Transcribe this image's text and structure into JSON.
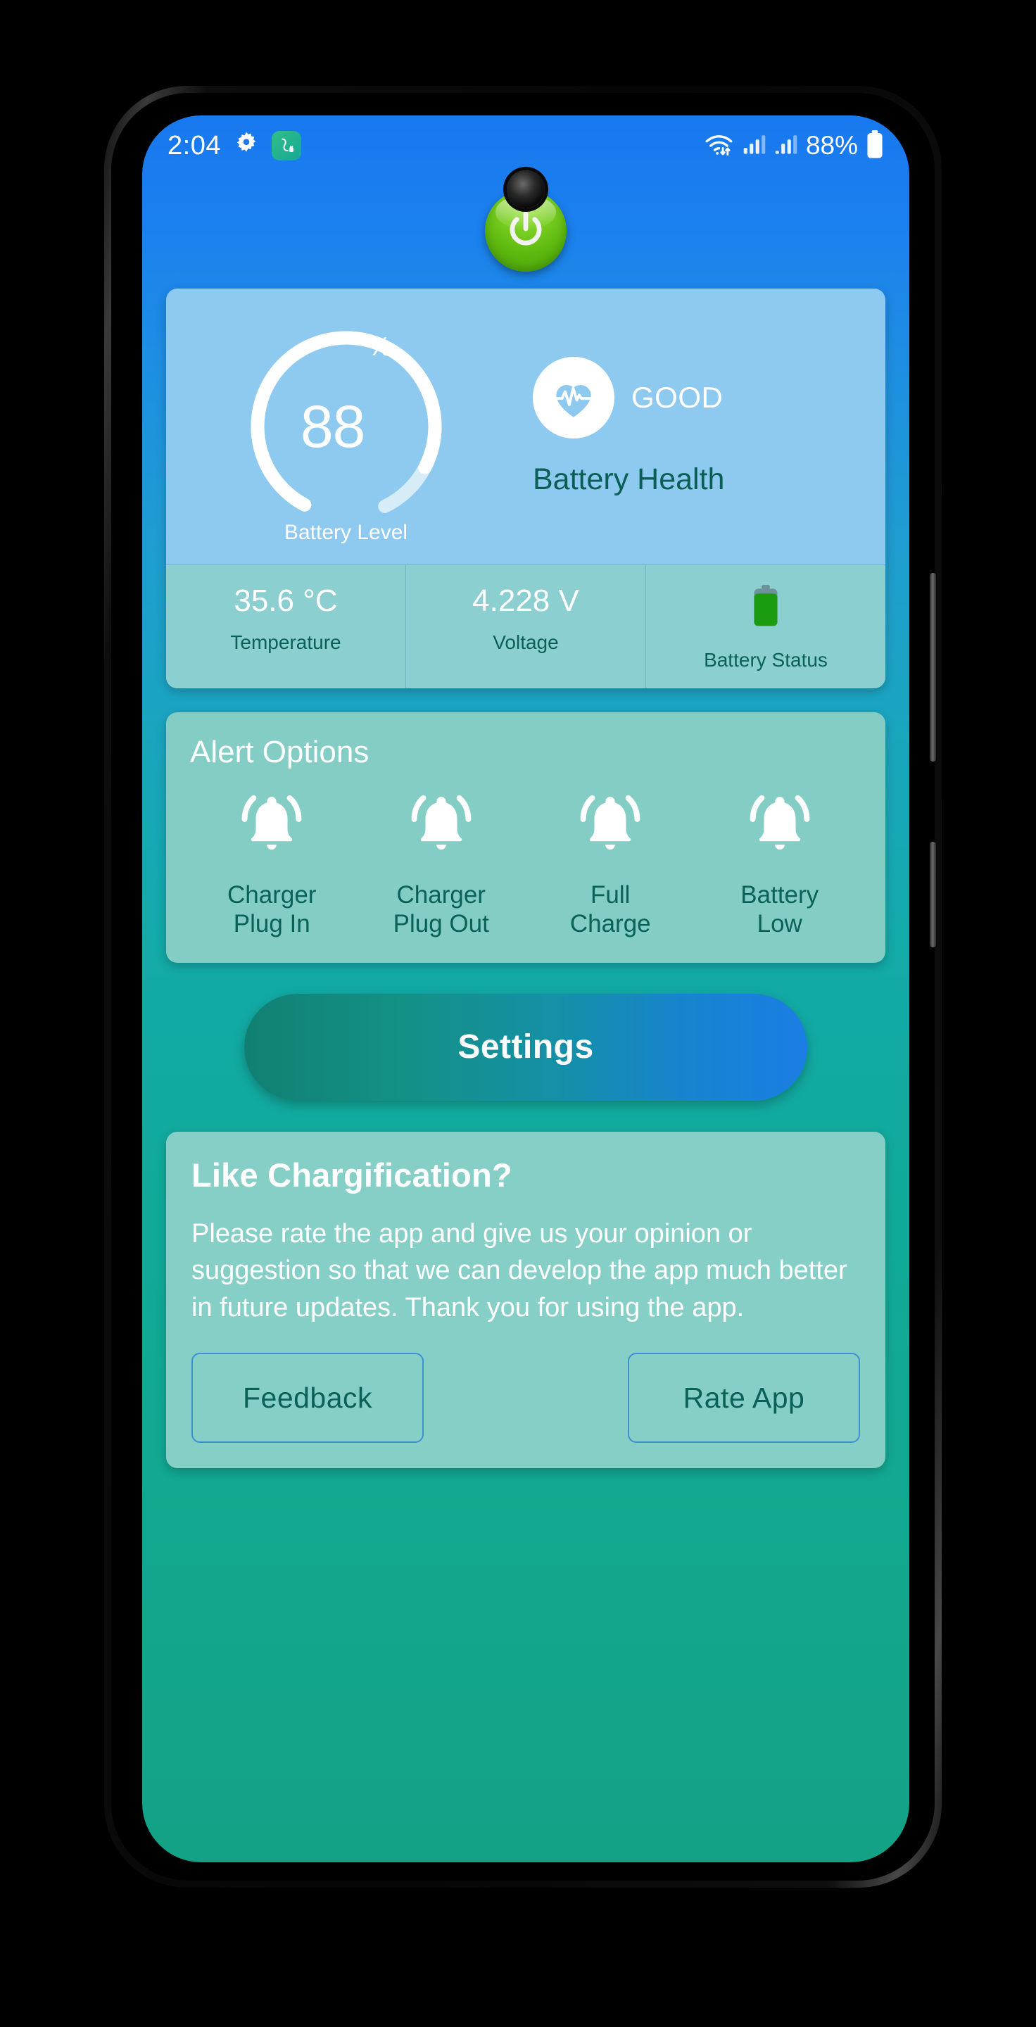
{
  "statusbar": {
    "time": "2:04",
    "gear_icon": "gear-icon",
    "app_icon": "charger-plug-icon",
    "wifi_icon": "wifi-icon",
    "signal_icon_1": "signal-bars-icon",
    "signal_icon_2": "signal-bars-icon",
    "battery_percent": "88%",
    "battery_icon": "battery-full-icon"
  },
  "app": {
    "power_button_icon": "power-icon"
  },
  "battery_card": {
    "gauge": {
      "value": "88",
      "percent_symbol": "%",
      "label": "Battery Level",
      "level_number": 88,
      "track_color": "#d6ecf7",
      "arc_color": "#ffffff"
    },
    "health": {
      "icon": "heart-pulse-icon",
      "value": "GOOD",
      "label": "Battery Health"
    },
    "stats": [
      {
        "value": "35.6 °C",
        "label": "Temperature",
        "icon": null
      },
      {
        "value": "4.228 V",
        "label": "Voltage",
        "icon": null
      },
      {
        "value": "",
        "label": "Battery Status",
        "icon": "battery-vertical-icon"
      }
    ]
  },
  "alerts": {
    "title": "Alert Options",
    "items": [
      {
        "icon": "bell-ring-icon",
        "label": "Charger\nPlug In"
      },
      {
        "icon": "bell-ring-icon",
        "label": "Charger\nPlug Out"
      },
      {
        "icon": "bell-ring-icon",
        "label": "Full\nCharge"
      },
      {
        "icon": "bell-ring-icon",
        "label": "Battery\nLow"
      }
    ]
  },
  "settings_button": {
    "label": "Settings"
  },
  "rate_card": {
    "title": "Like Chargification?",
    "body": "Please rate the app and give us your opinion or suggestion so that we can develop the app much better in future updates. Thank you for using the app.",
    "feedback_label": "Feedback",
    "rate_label": "Rate App"
  },
  "colors": {
    "bg_top": "#1878ef",
    "bg_bottom": "#14a286",
    "card_blue": "#8ec9ef",
    "card_stats": "#8ccfd0",
    "card_teal": "#83cdc5",
    "accent_green": "#5cb70e",
    "text_dark_teal": "#0a6158",
    "button_border": "#3f8fd4"
  }
}
